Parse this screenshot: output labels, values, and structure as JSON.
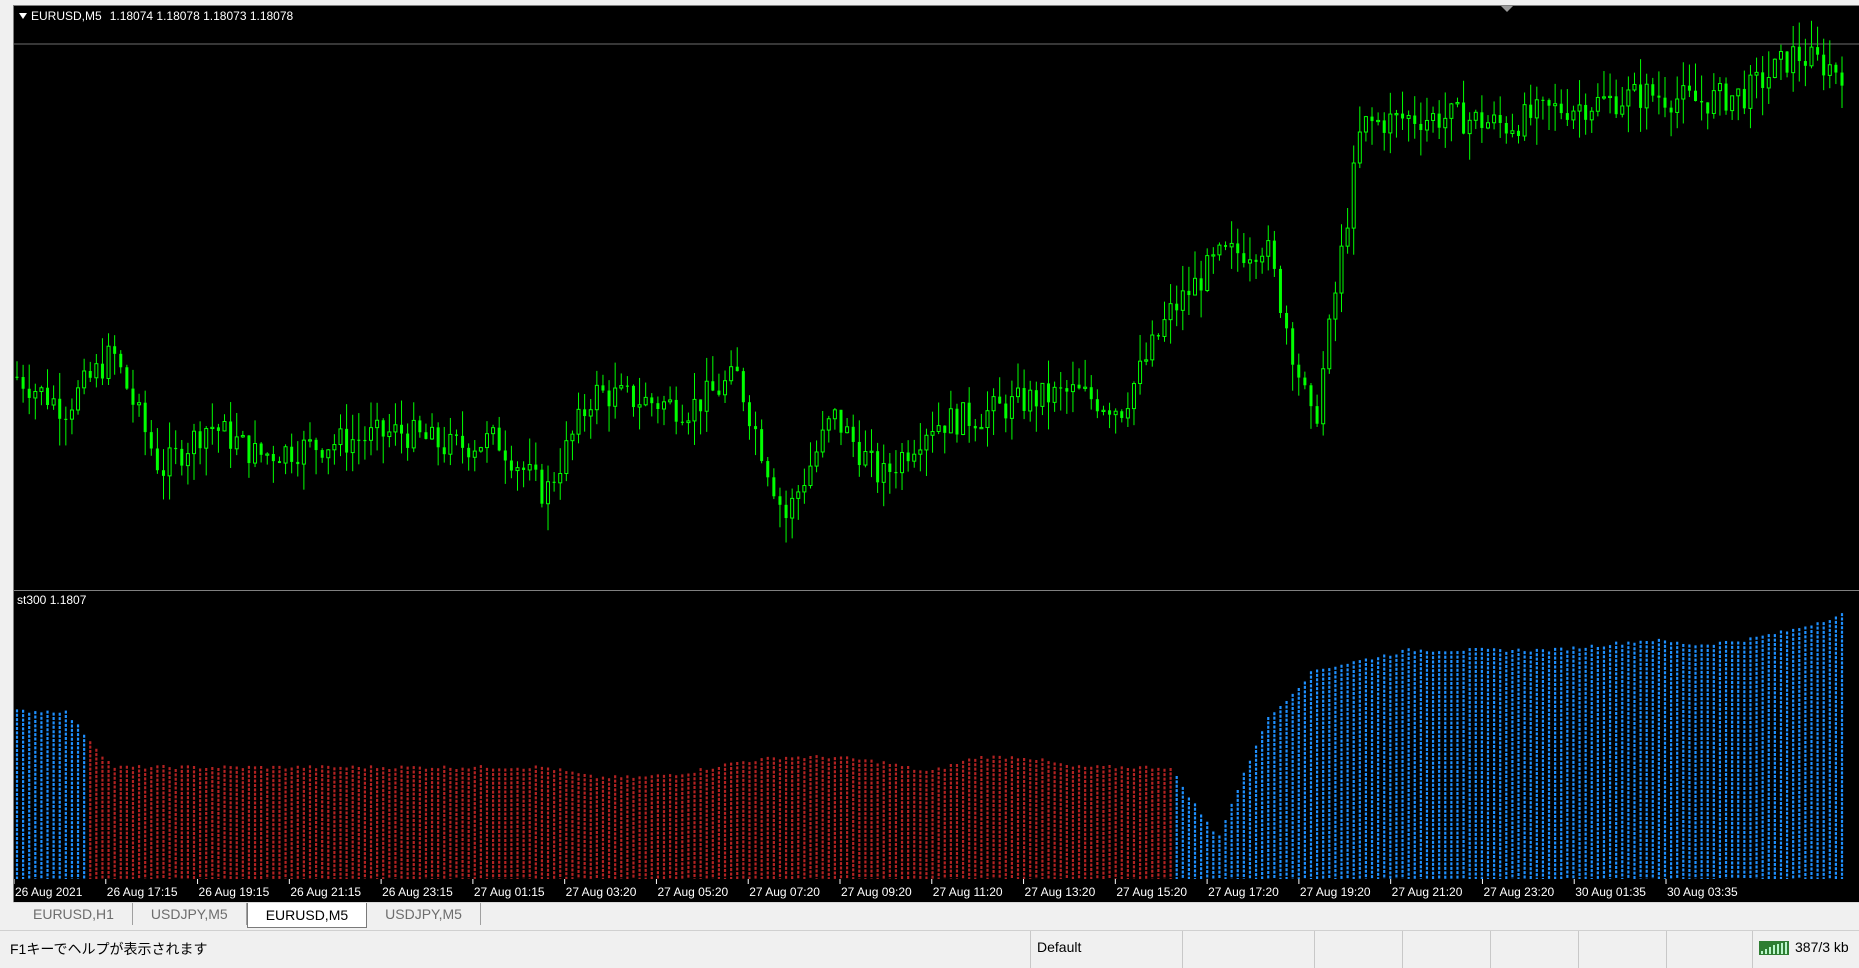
{
  "main_pane": {
    "symbol_label": "EURUSD,M5",
    "ohlc_text": "1.18074 1.18078 1.18073 1.18078"
  },
  "indicator_pane": {
    "label": "st300 1.1807"
  },
  "colors": {
    "background": "#000000",
    "bull_candle": "#00ff00",
    "bear_candle": "#00ff00",
    "histogram_up": "#1e90ff",
    "histogram_down": "#b22222",
    "separator": "#808080",
    "text": "#ffffff"
  },
  "chart_data": {
    "type": "line",
    "title": "EURUSD,M5",
    "x_tick_labels": [
      "26 Aug 2021",
      "26 Aug 17:15",
      "26 Aug 19:15",
      "26 Aug 21:15",
      "26 Aug 23:15",
      "27 Aug 01:15",
      "27 Aug 03:20",
      "27 Aug 05:20",
      "27 Aug 07:20",
      "27 Aug 09:20",
      "27 Aug 11:20",
      "27 Aug 13:20",
      "27 Aug 15:20",
      "27 Aug 17:20",
      "27 Aug 19:20",
      "27 Aug 21:20",
      "27 Aug 23:20",
      "30 Aug 01:35",
      "30 Aug 03:35"
    ],
    "series": [
      {
        "name": "EURUSD,M5",
        "values": [
          1.176,
          1.1756,
          1.1763,
          1.1748,
          1.1754,
          1.175,
          1.1751,
          1.1752,
          1.1753,
          1.1751,
          1.1752,
          1.1745,
          1.1758,
          1.1757,
          1.1756,
          1.176,
          1.1742,
          1.1755,
          1.1747,
          1.1754,
          1.1755,
          1.1757,
          1.1758,
          1.1756,
          1.1768,
          1.1775,
          1.1777,
          1.1753,
          1.1792,
          1.1793,
          1.1793,
          1.1792,
          1.1794,
          1.1795,
          1.1796,
          1.1795,
          1.1796,
          1.1801,
          1.1799
        ]
      },
      {
        "name": "st300",
        "values": [
          1.1758,
          1.1758,
          1.1747,
          1.1747,
          1.1747,
          1.1747,
          1.1747,
          1.1747,
          1.1747,
          1.1747,
          1.1747,
          1.1747,
          1.1745,
          1.1745,
          1.1746,
          1.1748,
          1.1749,
          1.1749,
          1.1748,
          1.1746,
          1.1749,
          1.1749,
          1.1747,
          1.1747,
          1.1747,
          1.1733,
          1.1756,
          1.1766,
          1.1768,
          1.177,
          1.177,
          1.177,
          1.177,
          1.1771,
          1.1772,
          1.1771,
          1.1772,
          1.1774,
          1.1777
        ]
      }
    ],
    "legend": "none",
    "grid": false
  },
  "tabs": [
    {
      "label": "EURUSD,H1",
      "active": false
    },
    {
      "label": "USDJPY,M5",
      "active": false
    },
    {
      "label": "EURUSD,M5",
      "active": true
    },
    {
      "label": "USDJPY,M5",
      "active": false
    }
  ],
  "status_bar": {
    "help_text": "F1キーでヘルプが表示されます",
    "profile": "Default",
    "traffic": "387/3 kb"
  }
}
